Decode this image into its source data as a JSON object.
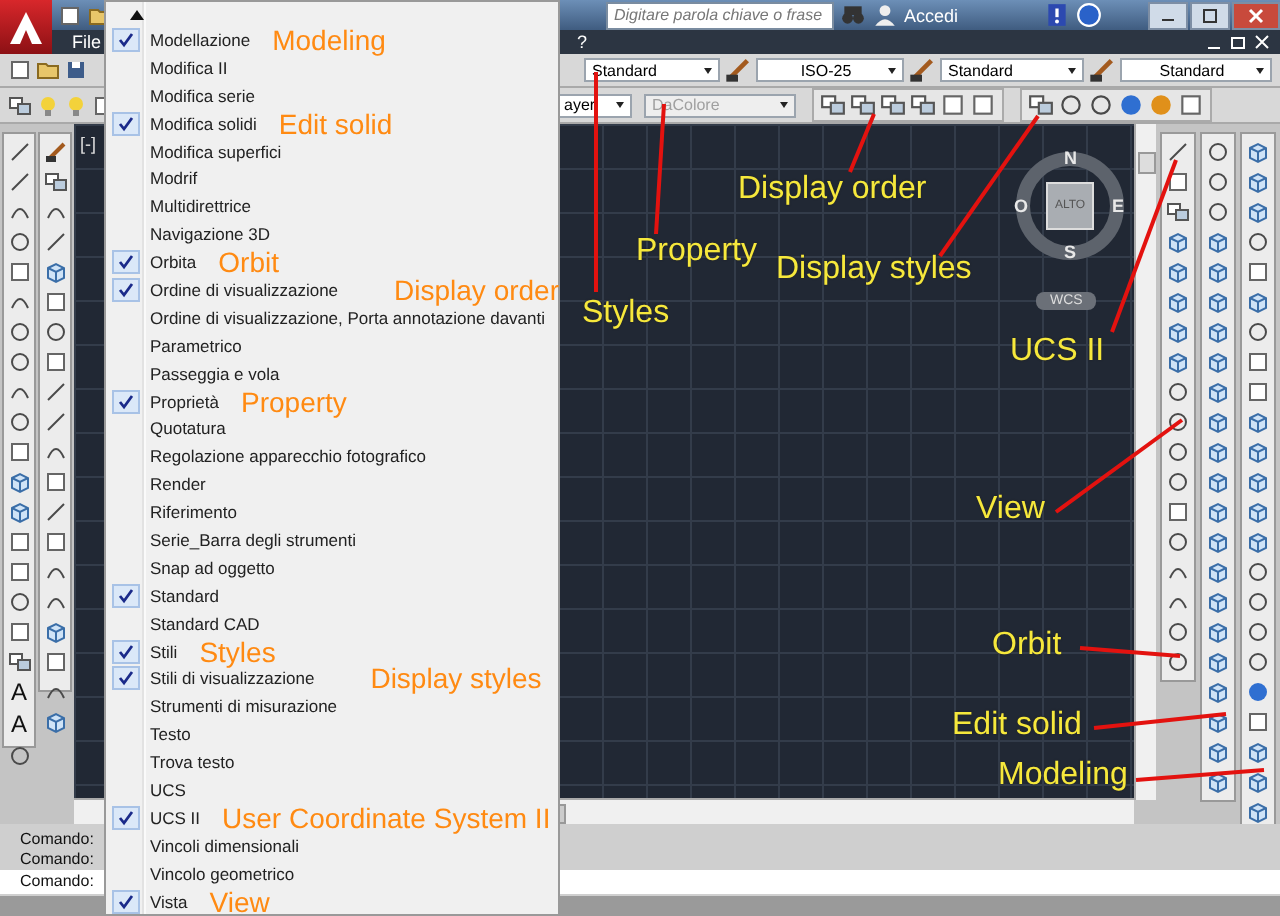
{
  "title_bar": {
    "search": {
      "placeholder": "Digitare parola chiave o frase"
    },
    "sign_in": "Accedi"
  },
  "menu_bar": {
    "items": [
      "File",
      "?"
    ]
  },
  "toolbar": {
    "dropdowns": [
      "Standard",
      "ISO-25",
      "Standard",
      "Standard"
    ],
    "layer_dropdown": "ayer",
    "color_dropdown": "DaColore"
  },
  "toolbar_menu": {
    "items": [
      {
        "label": "Modellazione",
        "checked": true,
        "annotation": "Modeling"
      },
      {
        "label": "Modifica II",
        "checked": false
      },
      {
        "label": "Modifica serie",
        "checked": false
      },
      {
        "label": "Modifica solidi",
        "checked": true,
        "annotation": "Edit solid"
      },
      {
        "label": "Modifica superfici",
        "checked": false
      },
      {
        "label": "Modrif",
        "checked": false
      },
      {
        "label": "Multidirettrice",
        "checked": false
      },
      {
        "label": "Navigazione 3D",
        "checked": false
      },
      {
        "label": "Orbita",
        "checked": true,
        "annotation": "Orbit"
      },
      {
        "label": "Ordine di visualizzazione",
        "checked": true,
        "annotation": "Display order"
      },
      {
        "label": "Ordine di visualizzazione, Porta annotazione davanti",
        "checked": false
      },
      {
        "label": "Parametrico",
        "checked": false
      },
      {
        "label": "Passeggia e vola",
        "checked": false
      },
      {
        "label": "Proprietà",
        "checked": true,
        "annotation": "Property"
      },
      {
        "label": "Quotatura",
        "checked": false
      },
      {
        "label": "Regolazione apparecchio fotografico",
        "checked": false
      },
      {
        "label": "Render",
        "checked": false
      },
      {
        "label": "Riferimento",
        "checked": false
      },
      {
        "label": "Serie_Barra degli strumenti",
        "checked": false
      },
      {
        "label": "Snap ad oggetto",
        "checked": false
      },
      {
        "label": "Standard",
        "checked": true
      },
      {
        "label": "Standard CAD",
        "checked": false
      },
      {
        "label": "Stili",
        "checked": true,
        "annotation": "Styles"
      },
      {
        "label": "Stili di visualizzazione",
        "checked": true,
        "annotation": "Display styles"
      },
      {
        "label": "Strumenti di misurazione",
        "checked": false
      },
      {
        "label": "Testo",
        "checked": false
      },
      {
        "label": "Trova testo",
        "checked": false
      },
      {
        "label": "UCS",
        "checked": false
      },
      {
        "label": "UCS II",
        "checked": true,
        "annotation": "User Coordinate System II"
      },
      {
        "label": "Vincoli dimensionali",
        "checked": false
      },
      {
        "label": "Vincolo geometrico",
        "checked": false
      },
      {
        "label": "Vista",
        "checked": true,
        "annotation": "View"
      }
    ]
  },
  "viewport": {
    "label": "[-]",
    "compass": {
      "north": "N",
      "east": "E",
      "south": "S",
      "west": "O",
      "center": "ALTO"
    },
    "ucs_button": "WCS"
  },
  "left_toolbar": {
    "text_tools": [
      "A",
      "A"
    ]
  },
  "callouts": [
    "Styles",
    "Property",
    "Display order",
    "Display styles",
    "UCS II",
    "View",
    "Orbit",
    "Edit solid",
    "Modeling"
  ],
  "command_line": {
    "lines": [
      "Comando:",
      "Comando:",
      "Comando:"
    ]
  }
}
